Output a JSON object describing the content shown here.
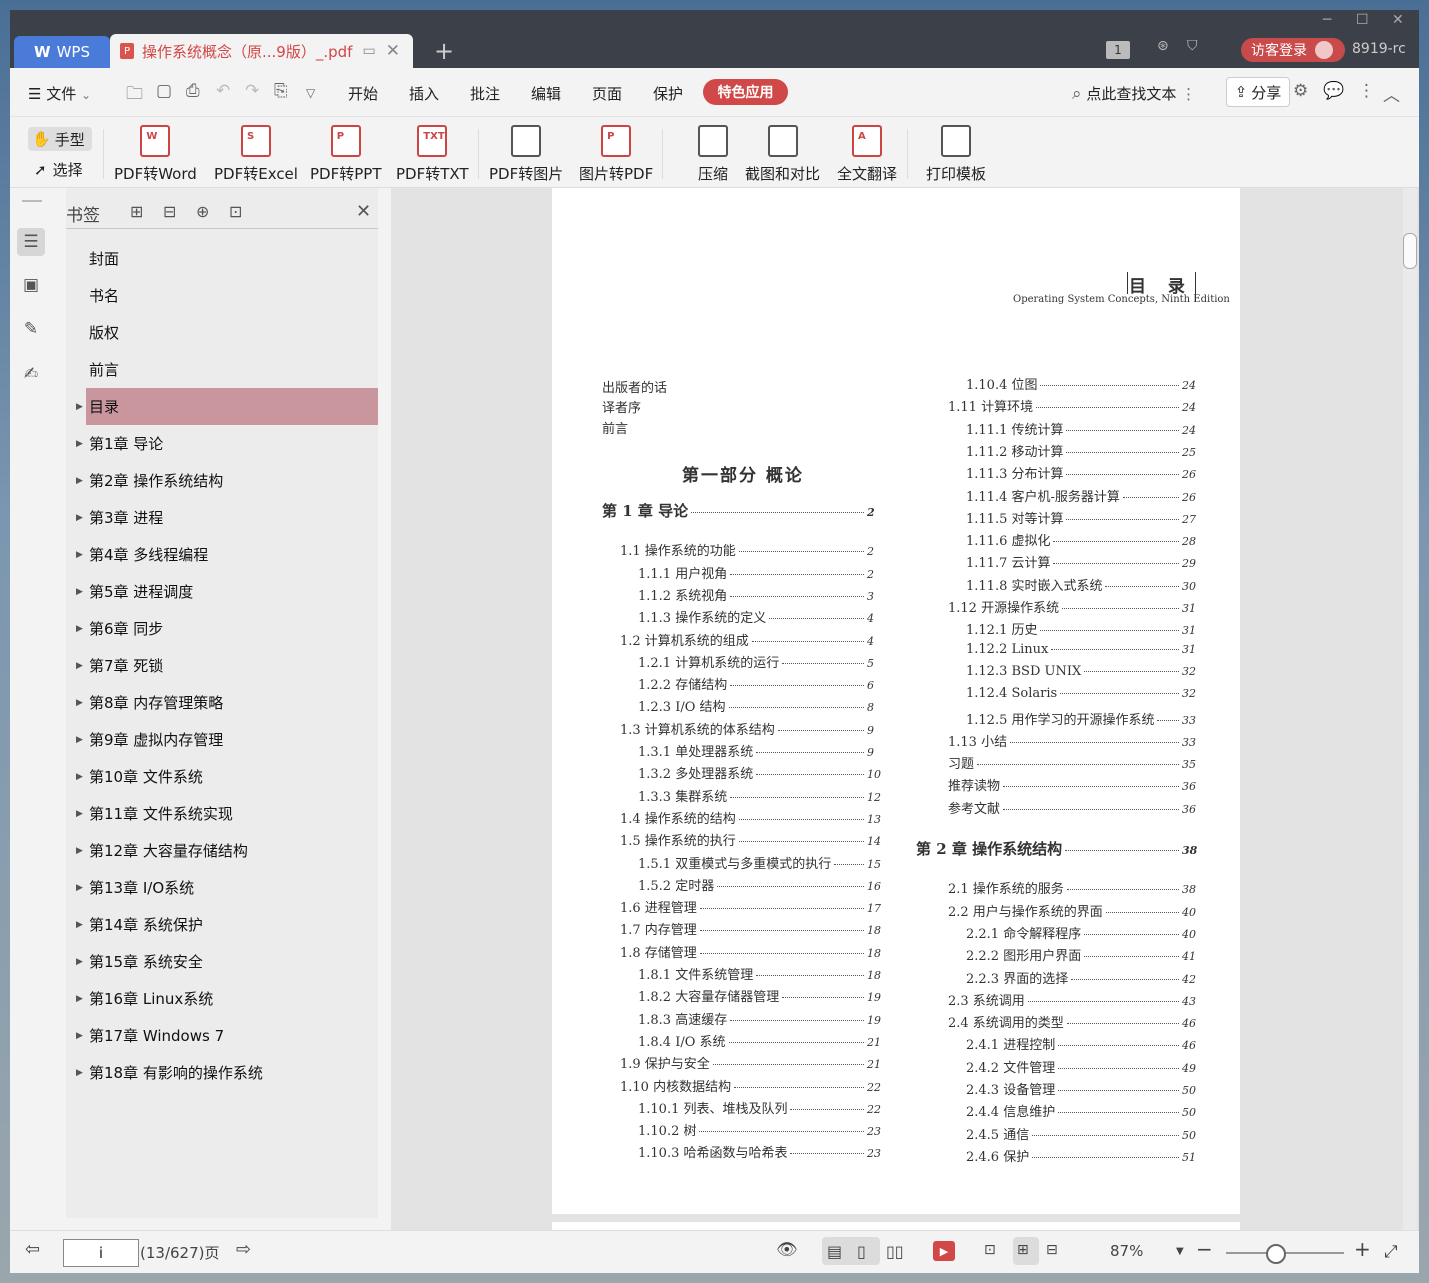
{
  "titlebar": {
    "app_tab": "WPS",
    "doc_tab": "操作系统概念（原...9版）_.pdf",
    "page_badge": "1",
    "login": "访客登录",
    "user_id": "8919-rc"
  },
  "menu": {
    "file": "文件",
    "items": [
      "开始",
      "插入",
      "批注",
      "编辑",
      "页面",
      "保护"
    ],
    "special": "特色应用",
    "search": "点此查找文本",
    "share": "分享"
  },
  "toolbar": {
    "hand": "手型",
    "select": "选择",
    "buttons": [
      "PDF转Word",
      "PDF转Excel",
      "PDF转PPT",
      "PDF转TXT",
      "PDF转图片",
      "图片转PDF",
      "压缩",
      "截图和对比",
      "全文翻译",
      "打印模板"
    ]
  },
  "bookmarks": {
    "title": "书签",
    "items": [
      "封面",
      "书名",
      "版权",
      "前言",
      "目录",
      "第1章  导论",
      "第2章  操作系统结构",
      "第3章  进程",
      "第4章  多线程编程",
      "第5章  进程调度",
      "第6章  同步",
      "第7章  死锁",
      "第8章  内存管理策略",
      "第9章  虚拟内存管理",
      "第10章  文件系统",
      "第11章  文件系统实现",
      "第12章  大容量存储结构",
      "第13章  I/O系统",
      "第14章  系统保护",
      "第15章  系统安全",
      "第16章  Linux系统",
      "第17章  Windows 7",
      "第18章  有影响的操作系统"
    ]
  },
  "page": {
    "header": "目 录",
    "subheader": "Operating System Concepts, Ninth Edition",
    "front": [
      "出版者的话",
      "译者序",
      "前言"
    ],
    "part": "第一部分   概论",
    "left": [
      {
        "t": "第 1 章    导论",
        "p": "2"
      },
      {
        "t": "1.1    操作系统的功能",
        "p": "2"
      },
      {
        "t": "1.1.1    用户视角",
        "p": "2"
      },
      {
        "t": "1.1.2    系统视角",
        "p": "3"
      },
      {
        "t": "1.1.3    操作系统的定义",
        "p": "4"
      },
      {
        "t": "1.2    计算机系统的组成",
        "p": "4"
      },
      {
        "t": "1.2.1    计算机系统的运行",
        "p": "5"
      },
      {
        "t": "1.2.2    存储结构",
        "p": "6"
      },
      {
        "t": "1.2.3    I/O 结构",
        "p": "8"
      },
      {
        "t": "1.3    计算机系统的体系结构",
        "p": "9"
      },
      {
        "t": "1.3.1    单处理器系统",
        "p": "9"
      },
      {
        "t": "1.3.2    多处理器系统",
        "p": "10"
      },
      {
        "t": "1.3.3    集群系统",
        "p": "12"
      },
      {
        "t": "1.4    操作系统的结构",
        "p": "13"
      },
      {
        "t": "1.5    操作系统的执行",
        "p": "14"
      },
      {
        "t": "1.5.1    双重模式与多重模式的执行",
        "p": "15"
      },
      {
        "t": "1.5.2    定时器",
        "p": "16"
      },
      {
        "t": "1.6    进程管理",
        "p": "17"
      },
      {
        "t": "1.7    内存管理",
        "p": "18"
      },
      {
        "t": "1.8    存储管理",
        "p": "18"
      },
      {
        "t": "1.8.1    文件系统管理",
        "p": "18"
      },
      {
        "t": "1.8.2    大容量存储器管理",
        "p": "19"
      },
      {
        "t": "1.8.3    高速缓存",
        "p": "19"
      },
      {
        "t": "1.8.4    I/O 系统",
        "p": "21"
      },
      {
        "t": "1.9    保护与安全",
        "p": "21"
      },
      {
        "t": "1.10  内核数据结构",
        "p": "22"
      },
      {
        "t": "1.10.1    列表、堆栈及队列",
        "p": "22"
      },
      {
        "t": "1.10.2    树",
        "p": "23"
      },
      {
        "t": "1.10.3    哈希函数与哈希表",
        "p": "23"
      }
    ],
    "right": [
      {
        "t": "1.10.4    位图",
        "p": "24"
      },
      {
        "t": "1.11    计算环境",
        "p": "24"
      },
      {
        "t": "1.11.1    传统计算",
        "p": "24"
      },
      {
        "t": "1.11.2    移动计算",
        "p": "25"
      },
      {
        "t": "1.11.3    分布计算",
        "p": "26"
      },
      {
        "t": "1.11.4    客户机-服务器计算",
        "p": "26"
      },
      {
        "t": "1.11.5    对等计算",
        "p": "27"
      },
      {
        "t": "1.11.6    虚拟化",
        "p": "28"
      },
      {
        "t": "1.11.7    云计算",
        "p": "29"
      },
      {
        "t": "1.11.8    实时嵌入式系统",
        "p": "30"
      },
      {
        "t": "1.12    开源操作系统",
        "p": "31"
      },
      {
        "t": "1.12.1    历史",
        "p": "31"
      },
      {
        "t": "1.12.2    Linux",
        "p": "31"
      },
      {
        "t": "1.12.3    BSD UNIX",
        "p": "32"
      },
      {
        "t": "1.12.4    Solaris",
        "p": "32"
      },
      {
        "t": "1.12.5    用作学习的开源操作系统",
        "p": "33"
      },
      {
        "t": "1.13    小结",
        "p": "33"
      },
      {
        "t": "习题",
        "p": "35"
      },
      {
        "t": "推荐读物",
        "p": "36"
      },
      {
        "t": "参考文献",
        "p": "36"
      },
      {
        "t": "第 2 章    操作系统结构",
        "p": "38"
      },
      {
        "t": "2.1    操作系统的服务",
        "p": "38"
      },
      {
        "t": "2.2    用户与操作系统的界面",
        "p": "40"
      },
      {
        "t": "2.2.1    命令解释程序",
        "p": "40"
      },
      {
        "t": "2.2.2    图形用户界面",
        "p": "41"
      },
      {
        "t": "2.2.3    界面的选择",
        "p": "42"
      },
      {
        "t": "2.3    系统调用",
        "p": "43"
      },
      {
        "t": "2.4    系统调用的类型",
        "p": "46"
      },
      {
        "t": "2.4.1    进程控制",
        "p": "46"
      },
      {
        "t": "2.4.2    文件管理",
        "p": "49"
      },
      {
        "t": "2.4.3    设备管理",
        "p": "50"
      },
      {
        "t": "2.4.4    信息维护",
        "p": "50"
      },
      {
        "t": "2.4.5    通信",
        "p": "50"
      },
      {
        "t": "2.4.6    保护",
        "p": "51"
      }
    ]
  },
  "status": {
    "page_input": "i",
    "page_count": "(13/627)页",
    "zoom": "87%"
  }
}
